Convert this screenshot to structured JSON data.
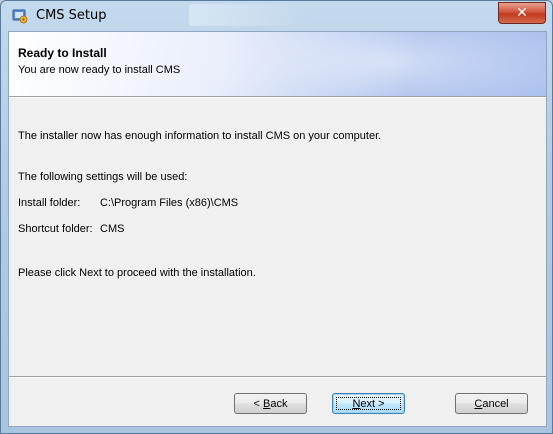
{
  "window": {
    "title": "CMS Setup"
  },
  "banner": {
    "title": "Ready to Install",
    "subtitle": "You are now ready to install CMS"
  },
  "body": {
    "intro": "The installer now has enough information to install CMS on your computer.",
    "settings_heading": "The following settings will be used:",
    "install_folder_label": "Install folder:",
    "install_folder_value": "C:\\Program Files (x86)\\CMS",
    "shortcut_folder_label": "Shortcut folder:",
    "shortcut_folder_value": "CMS",
    "instruction": "Please click Next to proceed with the installation."
  },
  "buttons": {
    "back_prefix": "< ",
    "back_accel": "B",
    "back_rest": "ack",
    "next_accel": "N",
    "next_rest": "ext >",
    "cancel_accel": "C",
    "cancel_rest": "ancel"
  },
  "colors": {
    "accent": "#3c7fb1",
    "close": "#c0391f"
  }
}
